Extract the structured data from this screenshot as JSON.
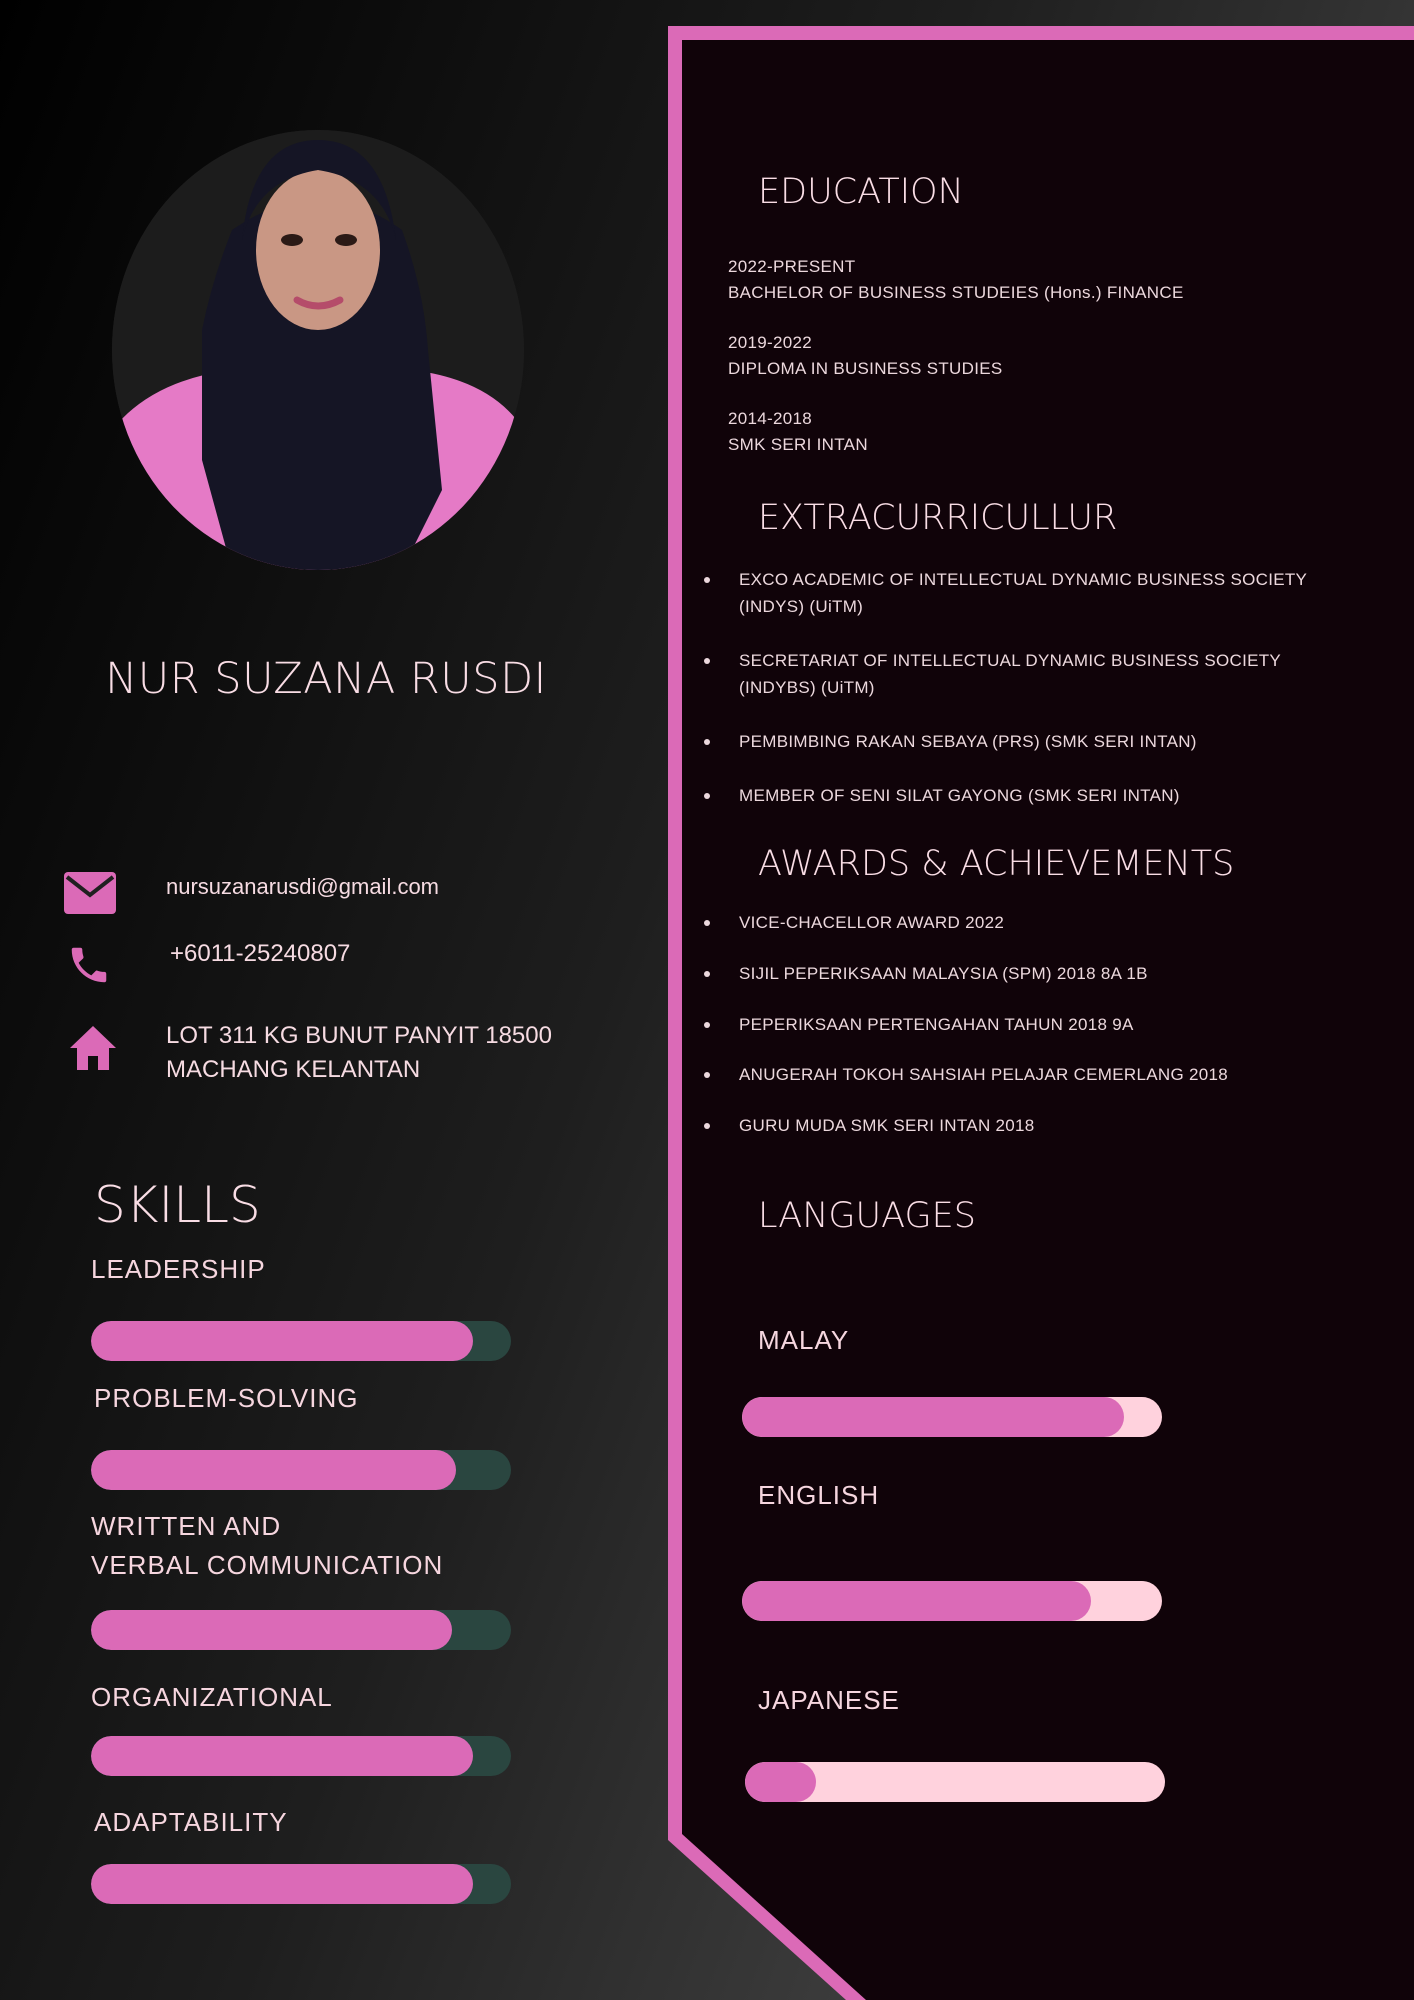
{
  "profile": {
    "name": "NUR SUZANA RUSDI"
  },
  "contact": {
    "email": "nursuzanarusdi@gmail.com",
    "phone": "+6011-25240807",
    "address_line1": "LOT 311 KG BUNUT PANYIT 18500",
    "address_line2": "MACHANG KELANTAN",
    "icons": [
      "envelope-icon",
      "phone-icon",
      "home-icon"
    ]
  },
  "skills": {
    "title": "SKILLS",
    "items": [
      {
        "label": "LEADERSHIP",
        "level": 0.91
      },
      {
        "label": "PROBLEM-SOLVING",
        "level": 0.87
      },
      {
        "label_line1": "WRITTEN AND",
        "label_line2": "VERBAL COMMUNICATION",
        "level": 0.86
      },
      {
        "label": "ORGANIZATIONAL",
        "level": 0.91
      },
      {
        "label": "ADAPTABILITY",
        "level": 0.91
      }
    ]
  },
  "education": {
    "title": "EDUCATION",
    "items": [
      {
        "years": "2022-PRESENT",
        "program": "BACHELOR OF BUSINESS STUDEIES (Hons.) FINANCE"
      },
      {
        "years": "2019-2022",
        "program": "DIPLOMA IN BUSINESS STUDIES"
      },
      {
        "years": "2014-2018",
        "program": "SMK SERI INTAN"
      }
    ]
  },
  "extracurricular": {
    "title": "EXTRACURRICULLUR",
    "items": [
      {
        "line1": "EXCO ACADEMIC OF INTELLECTUAL DYNAMIC BUSINESS SOCIETY",
        "line2": "(INDYS) (UiTM)"
      },
      {
        "line1": "SECRETARIAT OF INTELLECTUAL DYNAMIC BUSINESS SOCIETY",
        "line2": "(INDYBS) (UiTM)"
      },
      {
        "line1": "PEMBIMBING RAKAN SEBAYA (PRS) (SMK SERI INTAN)",
        "line2": ""
      },
      {
        "line1": "MEMBER OF SENI SILAT GAYONG (SMK SERI INTAN)",
        "line2": ""
      }
    ]
  },
  "awards": {
    "title": "AWARDS & ACHIEVEMENTS",
    "items": [
      "VICE-CHACELLOR AWARD  2022",
      "SIJIL PEPERIKSAAN MALAYSIA (SPM) 2018 8A 1B",
      "PEPERIKSAAN PERTENGAHAN TAHUN 2018 9A",
      "ANUGERAH TOKOH SAHSIAH PELAJAR CEMERLANG 2018",
      "GURU MUDA SMK SERI INTAN 2018"
    ]
  },
  "languages": {
    "title": "LANGUAGES",
    "items": [
      {
        "label": "MALAY",
        "level": 0.91
      },
      {
        "label": "ENGLISH",
        "level": 0.83
      },
      {
        "label": "JAPANESE",
        "level": 0.17
      }
    ]
  },
  "colors": {
    "accent": "#db6ab7",
    "panel": "#100309",
    "text": "#f7d6de",
    "skill_track": "#2a4640",
    "language_track": "#ffd2dd"
  }
}
